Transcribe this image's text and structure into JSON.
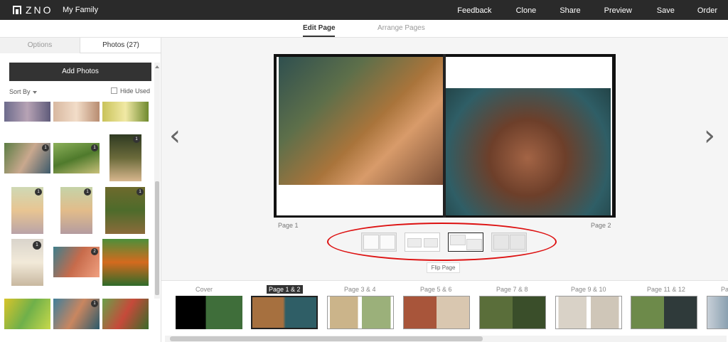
{
  "header": {
    "brand": "ZNO",
    "project_name": "My Family",
    "nav": [
      "Feedback",
      "Clone",
      "Share",
      "Preview",
      "Save",
      "Order"
    ]
  },
  "subnav": {
    "edit_page": "Edit Page",
    "arrange_pages": "Arrange Pages",
    "active": "Edit Page"
  },
  "left_panel": {
    "tabs": {
      "options": "Options",
      "photos": "Photos (27)"
    },
    "active_tab": "Photos (27)",
    "add_photos": "Add Photos",
    "sort_by": "Sort By",
    "hide_used": "Hide Used",
    "hide_used_checked": false,
    "photo_badges": [
      "1",
      "1",
      "1",
      "1",
      "1",
      "1",
      "1",
      "1",
      "2",
      "1"
    ]
  },
  "editor": {
    "page_left_label": "Page 1",
    "page_right_label": "Page 2",
    "prev_icon": "chevron-left-icon",
    "next_icon": "chevron-right-icon",
    "layout_options_count": 4,
    "selected_layout": 3,
    "flip_page": "Flip Page"
  },
  "filmstrip": {
    "labels": [
      "Cover",
      "Page 1 & 2",
      "Page 3 & 4",
      "Page 5 & 6",
      "Page 7 & 8",
      "Page 9 & 10",
      "Page 11 & 12",
      "Pa"
    ],
    "current": "Page 1 & 2"
  },
  "colors": {
    "header_bg": "#2a2a2a",
    "button_dark": "#333333",
    "highlight_ellipse": "#dd1111"
  }
}
